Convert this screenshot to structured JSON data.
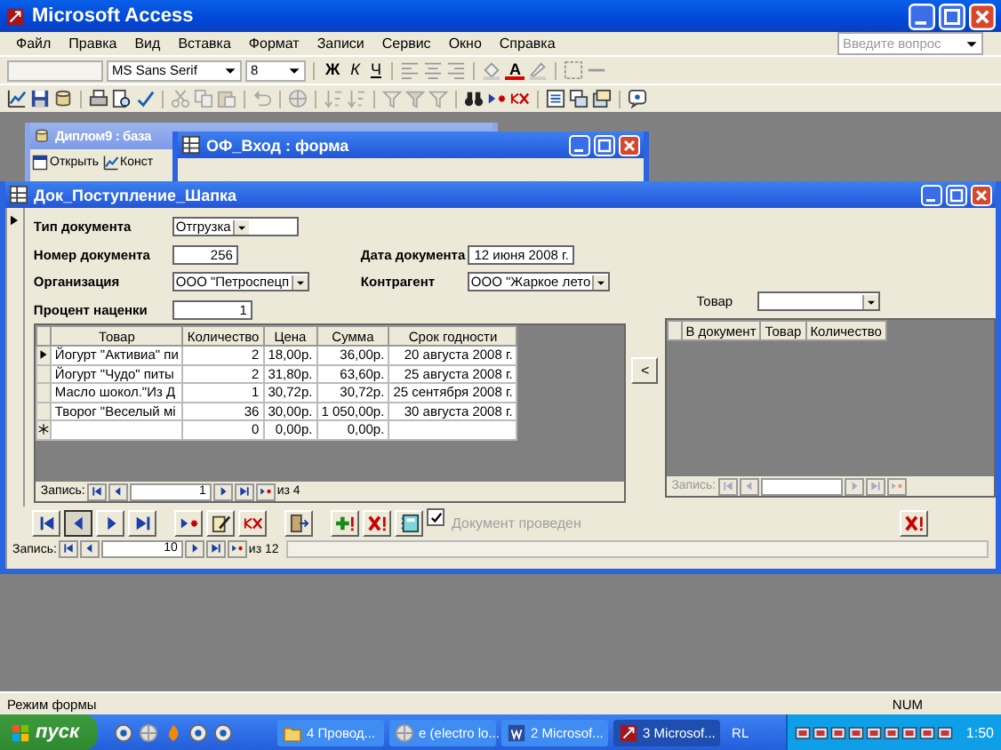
{
  "app_window": {
    "title": "Microsoft Access"
  },
  "menu": [
    "Файл",
    "Правка",
    "Вид",
    "Вставка",
    "Формат",
    "Записи",
    "Сервис",
    "Окно",
    "Справка"
  ],
  "help_search": {
    "placeholder": "Введите вопрос"
  },
  "formatting_toolbar": {
    "font": "MS Sans Serif",
    "font_size": "8",
    "bold": "Ж",
    "italic": "К",
    "underline": "Ч",
    "font_color": "A"
  },
  "background_windows": [
    {
      "title": "Диплом9 : база",
      "buttons": [
        "Открыть",
        "Конст"
      ]
    },
    {
      "title": "ОФ_Вход : форма"
    }
  ],
  "form": {
    "title": "Док_Поступление_Шапка",
    "doc_type": {
      "label": "Тип документа",
      "value": "Отгрузка"
    },
    "doc_number": {
      "label": "Номер документа",
      "value": "256"
    },
    "doc_date": {
      "label": "Дата документа",
      "value": "12 июня 2008 г."
    },
    "organization": {
      "label": "Организация",
      "value": "ООО \"Петроспецп"
    },
    "counterparty": {
      "label": "Контрагент",
      "value": "ООО \"Жаркое лето"
    },
    "markup_percent": {
      "label": "Процент наценки",
      "value": "1"
    },
    "items_table": {
      "columns": [
        "Товар",
        "Количество",
        "Цена",
        "Сумма",
        "Срок годности"
      ],
      "rows": [
        {
          "product": "Йогурт \"Активиа\" пи",
          "quantity": "2",
          "price": "18,00р.",
          "sum": "36,00р.",
          "expiry": "20 августа 2008 г.",
          "selected": true
        },
        {
          "product": "Йогурт \"Чудо\" питы",
          "quantity": "2",
          "price": "31,80р.",
          "sum": "63,60р.",
          "expiry": "25 августа 2008 г.",
          "selected": false
        },
        {
          "product": "Масло шокол.\"Из Д",
          "quantity": "1",
          "price": "30,72р.",
          "sum": "30,72р.",
          "expiry": "25 сентября 2008 г.",
          "selected": false
        },
        {
          "product": "Творог \"Веселый мі",
          "quantity": "36",
          "price": "30,00р.",
          "sum": "1 050,00р.",
          "expiry": "30 августа 2008 г.",
          "selected": false
        }
      ],
      "new_row": {
        "quantity": "0",
        "price": "0,00р.",
        "sum": "0,00р."
      },
      "navigator": {
        "label": "Запись:",
        "current": "1",
        "total": "из 4"
      }
    },
    "move_left_button": "<",
    "product_filter": {
      "label": "Товар"
    },
    "selection_table": {
      "columns": [
        "В документ",
        "Товар",
        "Количество"
      ],
      "navigator": {
        "label": "Запись:"
      }
    },
    "posted_checkbox": {
      "label": "Документ проведен",
      "checked": true,
      "disabled": true
    },
    "navigator": {
      "label": "Запись:",
      "current": "10",
      "total": "из 12"
    }
  },
  "status_bar": {
    "mode": "Режим формы",
    "num": "NUM"
  },
  "taskbar": {
    "start": "пуск",
    "tasks": [
      {
        "label": "4 Провод...",
        "selected": false
      },
      {
        "label": "e (electro lo...",
        "selected": false
      },
      {
        "label": "2 Microsof...",
        "selected": false
      },
      {
        "label": "3 Microsof...",
        "selected": true
      }
    ],
    "language": "RL",
    "clock": "1:50"
  }
}
